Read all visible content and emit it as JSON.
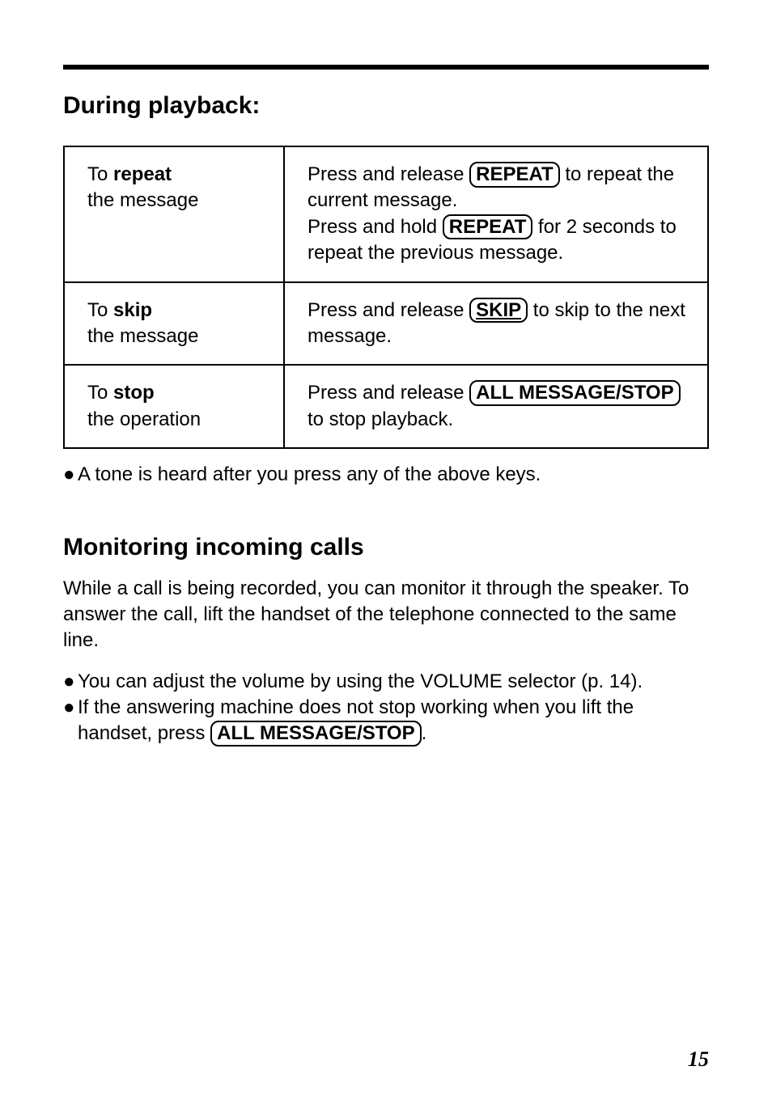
{
  "heading_playback": "During playback:",
  "table": {
    "row1": {
      "to": "To ",
      "action": "repeat",
      "object": "the message",
      "p1a": "Press and release ",
      "key1": "REPEAT",
      "p1b": " to repeat the current message.",
      "p2a": "Press and hold ",
      "key2": "REPEAT",
      "p2b": " for 2 seconds to repeat the previous message."
    },
    "row2": {
      "to": "To ",
      "action": "skip",
      "object": "the message",
      "p1a": "Press and release ",
      "key1": "SKIP",
      "p1b": " to skip to the next message."
    },
    "row3": {
      "to": "To ",
      "action": "stop",
      "object": "the operation",
      "p1a": "Press and release ",
      "key1": "ALL  MESSAGE/STOP",
      "p1b": " to stop playback."
    }
  },
  "note_after_table": {
    "bullet": "●",
    "text": "A tone is heard after you press any of the above keys."
  },
  "heading_monitoring": "Monitoring incoming calls",
  "monitoring_para": "While a call is being recorded, you can monitor it through the speaker. To answer the call, lift the handset of the telephone connected to the same line.",
  "monitoring_bullets": {
    "b1": {
      "bullet": "●",
      "text": "You can adjust the volume by using the VOLUME selector (p. 14)."
    },
    "b2": {
      "bullet": "●",
      "text_a": "If the answering machine does not stop working when you lift the handset, press ",
      "key": "ALL MESSAGE/STOP",
      "text_b": "."
    }
  },
  "page_number": "15"
}
